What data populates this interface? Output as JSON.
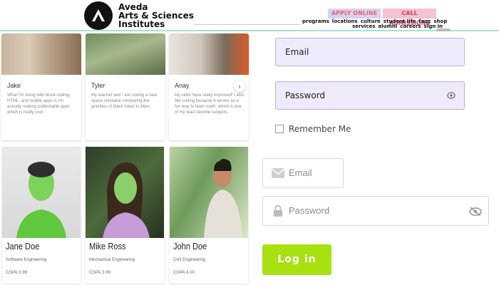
{
  "brand": {
    "line1": "Aveda",
    "line2": "Arts & Sciences",
    "line3": "Institutes"
  },
  "header": {
    "apply_label": "APPLY ONLINE",
    "call_label": "CALL ADMISSIONS",
    "nav_row1": [
      "programs",
      "locations",
      "culture",
      "student life",
      "faqs",
      "shop"
    ],
    "nav_row2": [
      "services",
      "alumni",
      "careers",
      "sign in"
    ]
  },
  "testimonials": [
    {
      "name": "Jake",
      "text": "What I'm doing with block coding, HTML, and mobile apps is I'm actually making publishable apps which is really cool."
    },
    {
      "name": "Tyler",
      "text": "My teacher and I are coding a new space simulator comparing the gravities of black holes to Mars"
    },
    {
      "name": "Anay",
      "text": "My skills have really improved! I also like coding because it serves as a fun way to learn math, which is one of my least favorite subjects."
    }
  ],
  "profiles": [
    {
      "name": "Jane Doe",
      "major": "Software Engineering",
      "gpa": "CGPA:3.98"
    },
    {
      "name": "Mike Ross",
      "major": "Mechanical Engineering",
      "gpa": "CGPA:3.99"
    },
    {
      "name": "John Doe",
      "major": "Civil Engineering",
      "gpa": "CGPA:4.00"
    }
  ],
  "form1": {
    "email_label": "Email",
    "password_label": "Password",
    "remember_label": "Remember Me"
  },
  "form2": {
    "email_placeholder": "Email",
    "password_placeholder": "Password",
    "login_label": "Log in"
  },
  "icons": {
    "next": "chevron-right-icon",
    "envelope": "envelope-icon",
    "lock": "lock-icon",
    "eye": "eye-icon",
    "eye_off": "eye-off-icon"
  },
  "colors": {
    "accent_green": "#a8e012",
    "input_fill": "#eeeafc",
    "apply_bg": "#d9d0f5",
    "call_bg": "#f4c2d0"
  }
}
